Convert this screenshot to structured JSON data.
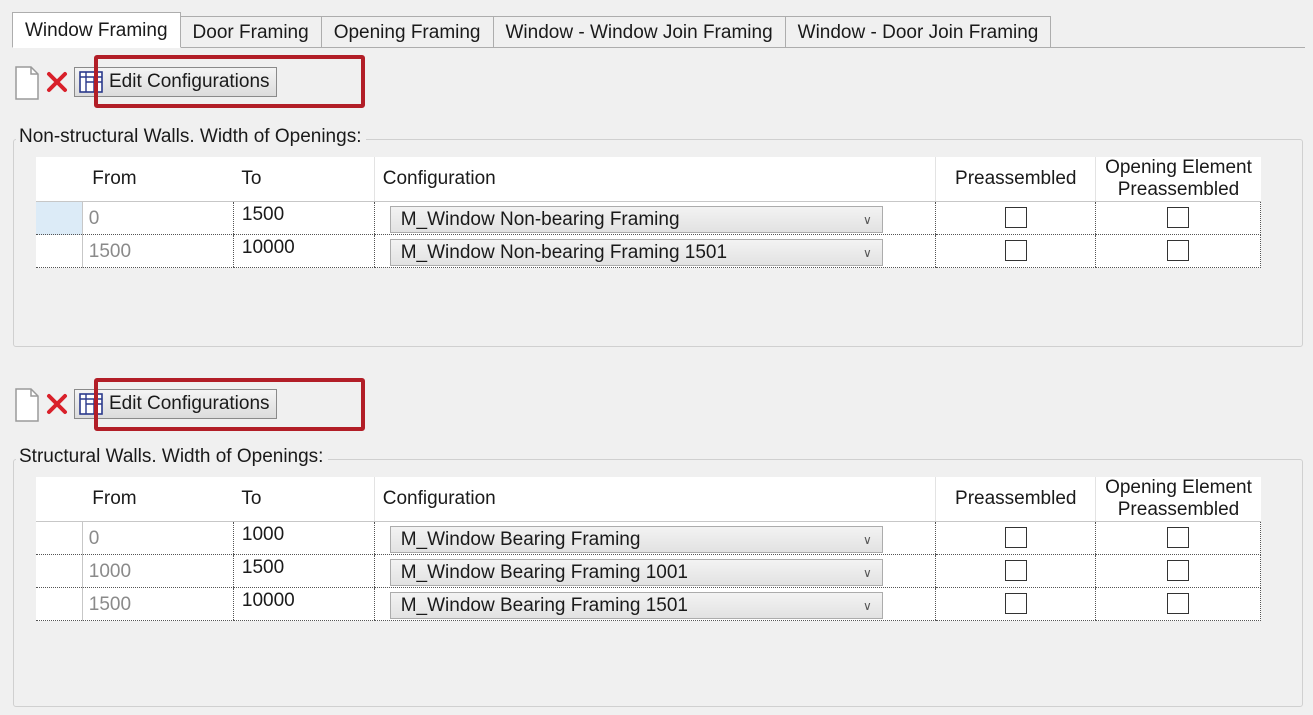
{
  "tabs": [
    {
      "label": "Window Framing",
      "active": true
    },
    {
      "label": "Door Framing",
      "active": false
    },
    {
      "label": "Opening Framing",
      "active": false
    },
    {
      "label": "Window - Window Join Framing",
      "active": false
    },
    {
      "label": "Window - Door Join Framing",
      "active": false
    }
  ],
  "toolbar": {
    "edit_label": "Edit Configurations",
    "new_icon": "new-document-icon",
    "delete_icon": "delete-x-icon",
    "edit_icon": "grid-config-icon"
  },
  "columns": {
    "from": "From",
    "to": "To",
    "configuration": "Configuration",
    "preassembled": "Preassembled",
    "opening_element_line1": "Opening Element",
    "opening_element_line2": "Preassembled"
  },
  "nonstructural": {
    "title": "Non-structural Walls. Width of Openings:",
    "rows": [
      {
        "from": "0",
        "to": "1500",
        "configuration": "M_Window Non-bearing Framing",
        "preassembled": false,
        "opening_element_preassembled": false
      },
      {
        "from": "1500",
        "to": "10000",
        "configuration": "M_Window Non-bearing Framing 1501",
        "preassembled": false,
        "opening_element_preassembled": false
      }
    ]
  },
  "structural": {
    "title": "Structural Walls. Width of Openings:",
    "rows": [
      {
        "from": "0",
        "to": "1000",
        "configuration": "M_Window Bearing Framing",
        "preassembled": false,
        "opening_element_preassembled": false
      },
      {
        "from": "1000",
        "to": "1500",
        "configuration": "M_Window Bearing Framing 1001",
        "preassembled": false,
        "opening_element_preassembled": false
      },
      {
        "from": "1500",
        "to": "10000",
        "configuration": "M_Window Bearing Framing 1501",
        "preassembled": false,
        "opening_element_preassembled": false
      }
    ]
  },
  "colors": {
    "highlight": "#b21e27",
    "delete": "#d9202a",
    "selected_row": "#dcebf7"
  }
}
